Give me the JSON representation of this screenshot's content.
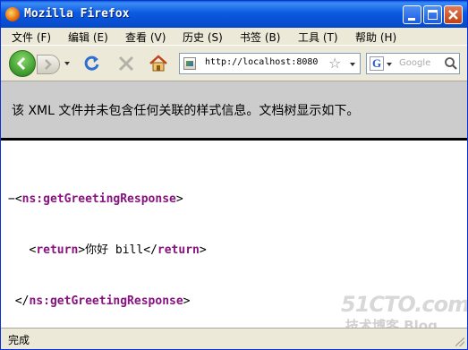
{
  "window": {
    "title": "Mozilla Firefox"
  },
  "menu": [
    {
      "label": "文件 (F)"
    },
    {
      "label": "编辑 (E)"
    },
    {
      "label": "查看 (V)"
    },
    {
      "label": "历史 (S)"
    },
    {
      "label": "书签 (B)"
    },
    {
      "label": "工具 (T)"
    },
    {
      "label": "帮助 (H)"
    }
  ],
  "nav": {
    "url": "http://localhost:8080",
    "search_placeholder": "Google",
    "search_engine_glyph": "G"
  },
  "content": {
    "notice": "该 XML 文件并未包含任何关联的样式信息。文档树显示如下。",
    "xml": {
      "collapse": "−",
      "root_tag": "ns:getGreetingResponse",
      "child_tag": "return",
      "child_text": "你好 bill"
    },
    "watermark_main": "51CTO.com",
    "watermark_sub": "技术博客  Blog"
  },
  "status": {
    "text": "完成"
  },
  "colors": {
    "titlebar": "#0a5ae0",
    "notice_bg": "#cccccc",
    "xml_tag": "#881280"
  }
}
